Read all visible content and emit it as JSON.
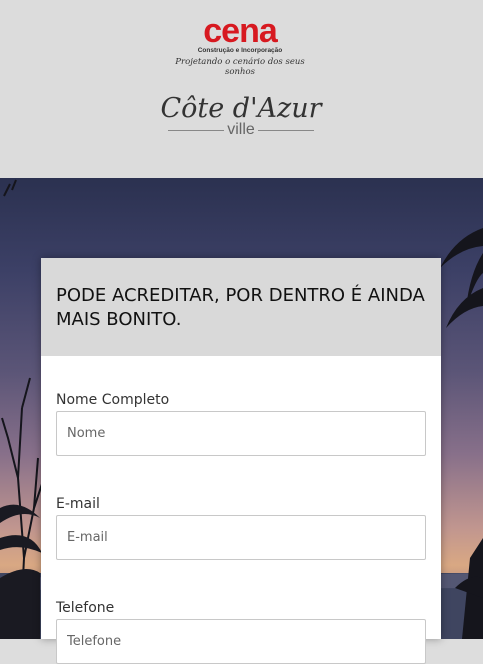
{
  "brand": {
    "name": "cena",
    "subtitle": "Construção e Incorporação",
    "tagline": "Projetando o cenário dos seus sonhos",
    "color": "#d71920"
  },
  "project": {
    "name": "Côte d'Azur",
    "sub": "ville"
  },
  "form": {
    "title": "PODE ACREDITAR, POR DENTRO É AINDA MAIS BONITO.",
    "fields": [
      {
        "label": "Nome Completo",
        "placeholder": "Nome"
      },
      {
        "label": "E-mail",
        "placeholder": "E-mail"
      },
      {
        "label": "Telefone",
        "placeholder": "Telefone"
      }
    ]
  }
}
